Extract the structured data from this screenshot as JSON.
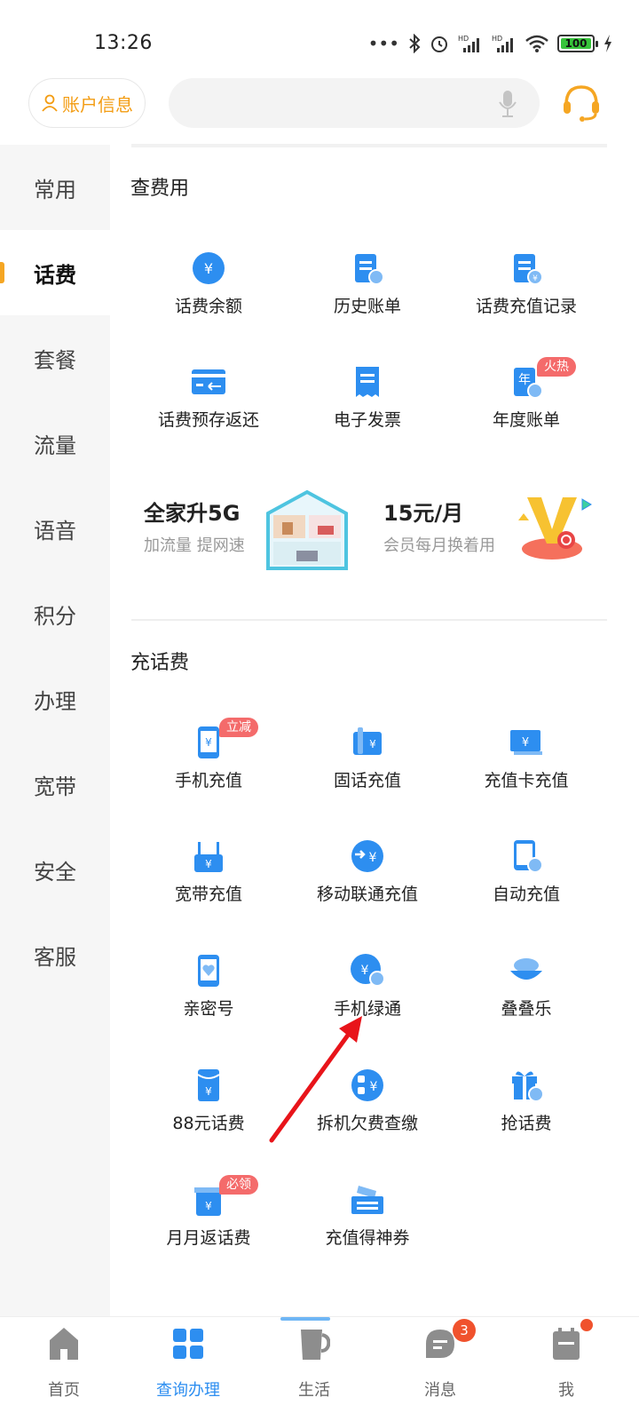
{
  "status_bar": {
    "time": "13:26",
    "battery": "100",
    "icons": [
      "more-dots-icon",
      "bluetooth-icon",
      "alarm-icon",
      "hd-signal-icon",
      "hd-signal-icon",
      "wifi-icon",
      "battery-icon",
      "charging-icon"
    ],
    "hd_label": "HD"
  },
  "header": {
    "account_label": "账户信息",
    "search_placeholder": "",
    "accent_color": "#f39c12"
  },
  "sidebar": {
    "items": [
      {
        "label": "常用",
        "active": false
      },
      {
        "label": "话费",
        "active": true
      },
      {
        "label": "套餐",
        "active": false
      },
      {
        "label": "流量",
        "active": false
      },
      {
        "label": "语音",
        "active": false
      },
      {
        "label": "积分",
        "active": false
      },
      {
        "label": "办理",
        "active": false
      },
      {
        "label": "宽带",
        "active": false
      },
      {
        "label": "安全",
        "active": false
      },
      {
        "label": "客服",
        "active": false
      }
    ]
  },
  "sections": {
    "query": {
      "title": "查费用",
      "items": [
        {
          "label": "话费余额",
          "icon": "yuan-circle-icon"
        },
        {
          "label": "历史账单",
          "icon": "bill-history-icon"
        },
        {
          "label": "话费充值记录",
          "icon": "recharge-record-icon"
        },
        {
          "label": "话费预存返还",
          "icon": "card-return-icon"
        },
        {
          "label": "电子发票",
          "icon": "invoice-icon"
        },
        {
          "label": "年度账单",
          "icon": "annual-bill-icon",
          "badge": "火热"
        }
      ]
    },
    "promo": {
      "left_title": "全家升5G",
      "left_sub": "加流量 提网速",
      "right_title": "15元/月",
      "right_sub": "会员每月换着用"
    },
    "recharge": {
      "title": "充话费",
      "items": [
        {
          "label": "手机充值",
          "icon": "phone-recharge-icon",
          "badge": "立减"
        },
        {
          "label": "固话充值",
          "icon": "landline-recharge-icon"
        },
        {
          "label": "充值卡充值",
          "icon": "recharge-card-icon"
        },
        {
          "label": "宽带充值",
          "icon": "broadband-recharge-icon"
        },
        {
          "label": "移动联通充值",
          "icon": "carrier-recharge-icon"
        },
        {
          "label": "自动充值",
          "icon": "auto-recharge-icon"
        },
        {
          "label": "亲密号",
          "icon": "intimate-number-icon"
        },
        {
          "label": "手机绿通",
          "icon": "green-channel-icon"
        },
        {
          "label": "叠叠乐",
          "icon": "stack-icon"
        },
        {
          "label": "88元话费",
          "icon": "red-packet-icon"
        },
        {
          "label": "拆机欠费查缴",
          "icon": "arrears-icon"
        },
        {
          "label": "抢话费",
          "icon": "gift-icon"
        },
        {
          "label": "月月返话费",
          "icon": "monthly-return-icon",
          "badge": "必领"
        },
        {
          "label": "充值得神券",
          "icon": "coupon-icon"
        }
      ]
    }
  },
  "bottom_nav": {
    "items": [
      {
        "label": "首页",
        "icon": "home-icon"
      },
      {
        "label": "查询办理",
        "icon": "grid-icon",
        "active": true
      },
      {
        "label": "生活",
        "icon": "cup-icon"
      },
      {
        "label": "消息",
        "icon": "message-icon",
        "badge": "3"
      },
      {
        "label": "我",
        "icon": "profile-icon",
        "dot": true
      }
    ]
  },
  "colors": {
    "primary_blue": "#2d8ef0",
    "badge_red": "#f46b6b",
    "orange": "#f39c12",
    "annotation_arrow": "#e8141a"
  }
}
